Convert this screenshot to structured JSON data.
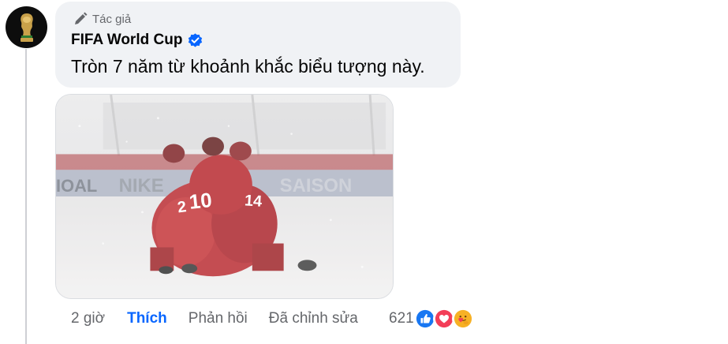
{
  "comment": {
    "author_badge": "Tác giả",
    "author_badge_icon": "pencil-icon",
    "author_name": "FIFA World Cup",
    "verified_icon": "verified-badge-icon",
    "text": "Tròn 7 năm từ khoảnh khắc biểu tượng này.",
    "avatar_icon": "fifa-world-cup-trophy-logo",
    "photo_alt": "Cầu thủ mặc áo đỏ ôm nhau trên sân tuyết"
  },
  "actions": {
    "time": "2 giờ",
    "like_label": "Thích",
    "reply_label": "Phản hồi",
    "edited_label": "Đã chỉnh sửa"
  },
  "reactions": {
    "count": "621",
    "icons": [
      "like-reaction-icon",
      "love-reaction-icon",
      "care-reaction-icon"
    ]
  },
  "colors": {
    "accent": "#0866ff",
    "bubble_bg": "#f0f2f5",
    "secondary_text": "#65676b",
    "like_reaction": "#1877f2",
    "love_reaction": "#f33e58",
    "care_reaction": "#f7b125"
  }
}
